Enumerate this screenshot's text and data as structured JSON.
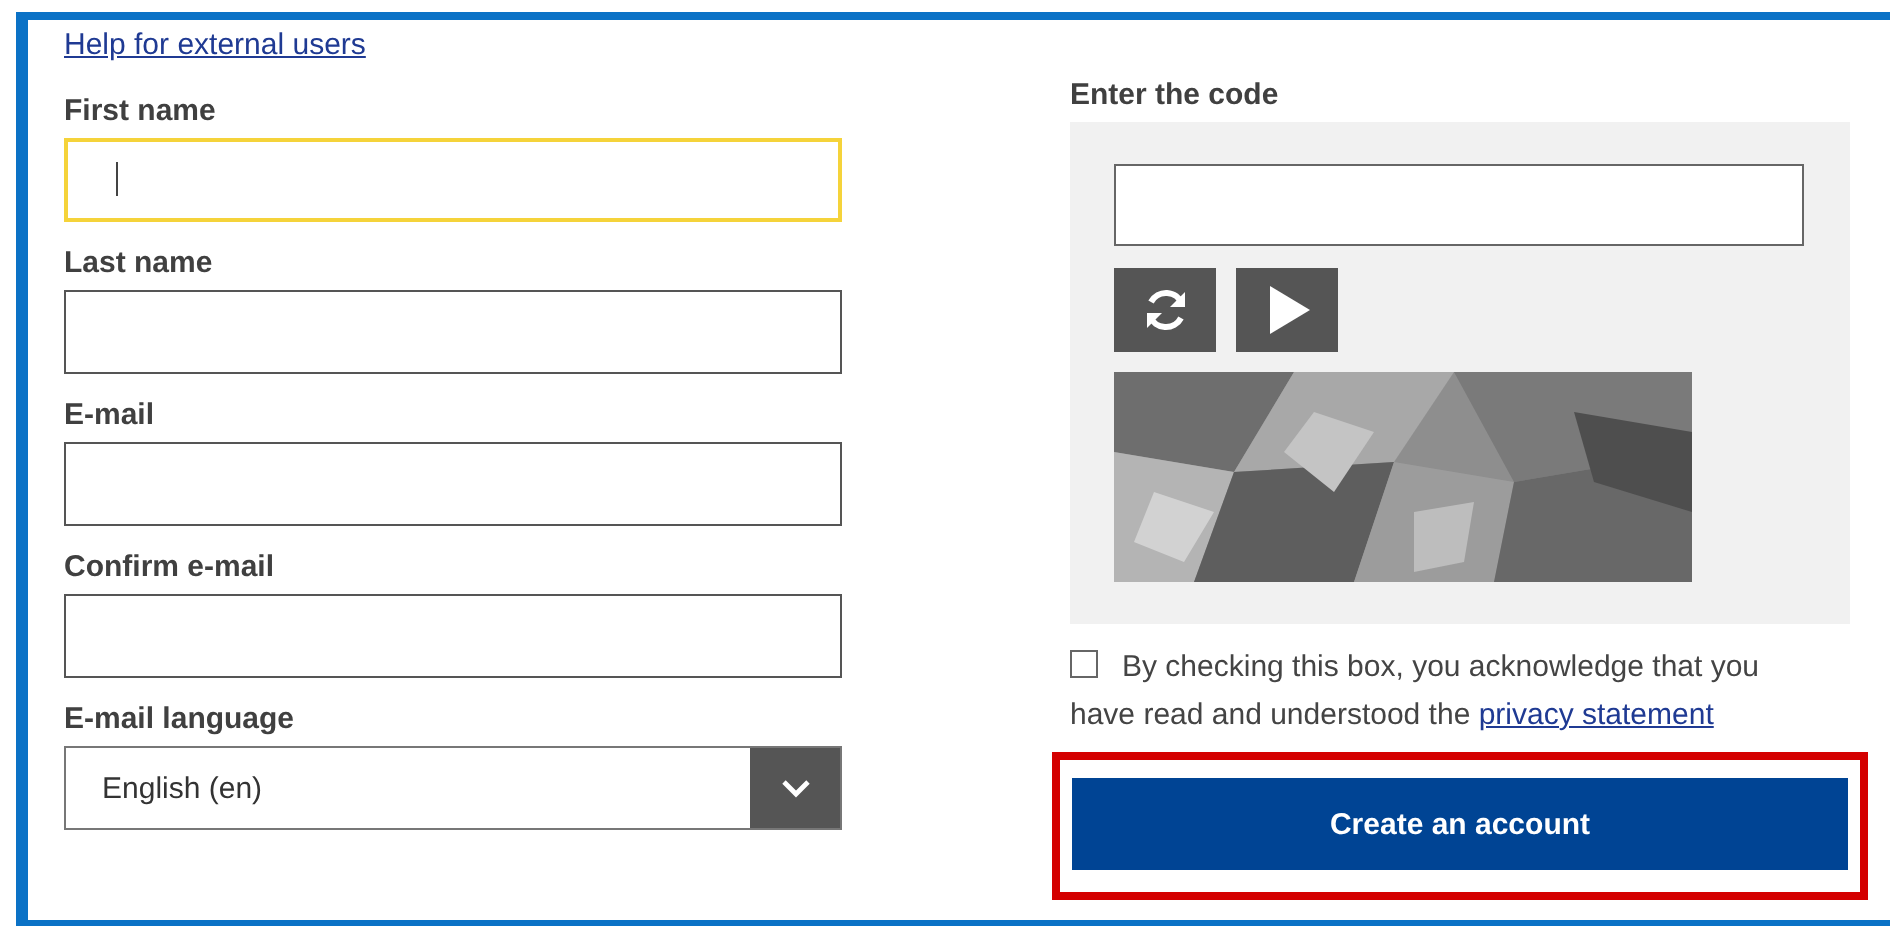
{
  "help_link": "Help for external users",
  "fields": [
    {
      "label": "First name",
      "kind": "text",
      "focused": true
    },
    {
      "label": "Last name",
      "kind": "text",
      "focused": false
    },
    {
      "label": "E-mail",
      "kind": "text",
      "focused": false
    },
    {
      "label": "Confirm e-mail",
      "kind": "text",
      "focused": false
    },
    {
      "label": "E-mail language",
      "kind": "select",
      "value": "English (en)",
      "focused": false
    }
  ],
  "captcha": {
    "label": "Enter the code"
  },
  "consent": {
    "checked": false,
    "text": "By checking this box, you acknowledge that you have read and understood the",
    "link": "privacy statement"
  },
  "submit": {
    "label": "Create an account",
    "highlighted": true
  }
}
